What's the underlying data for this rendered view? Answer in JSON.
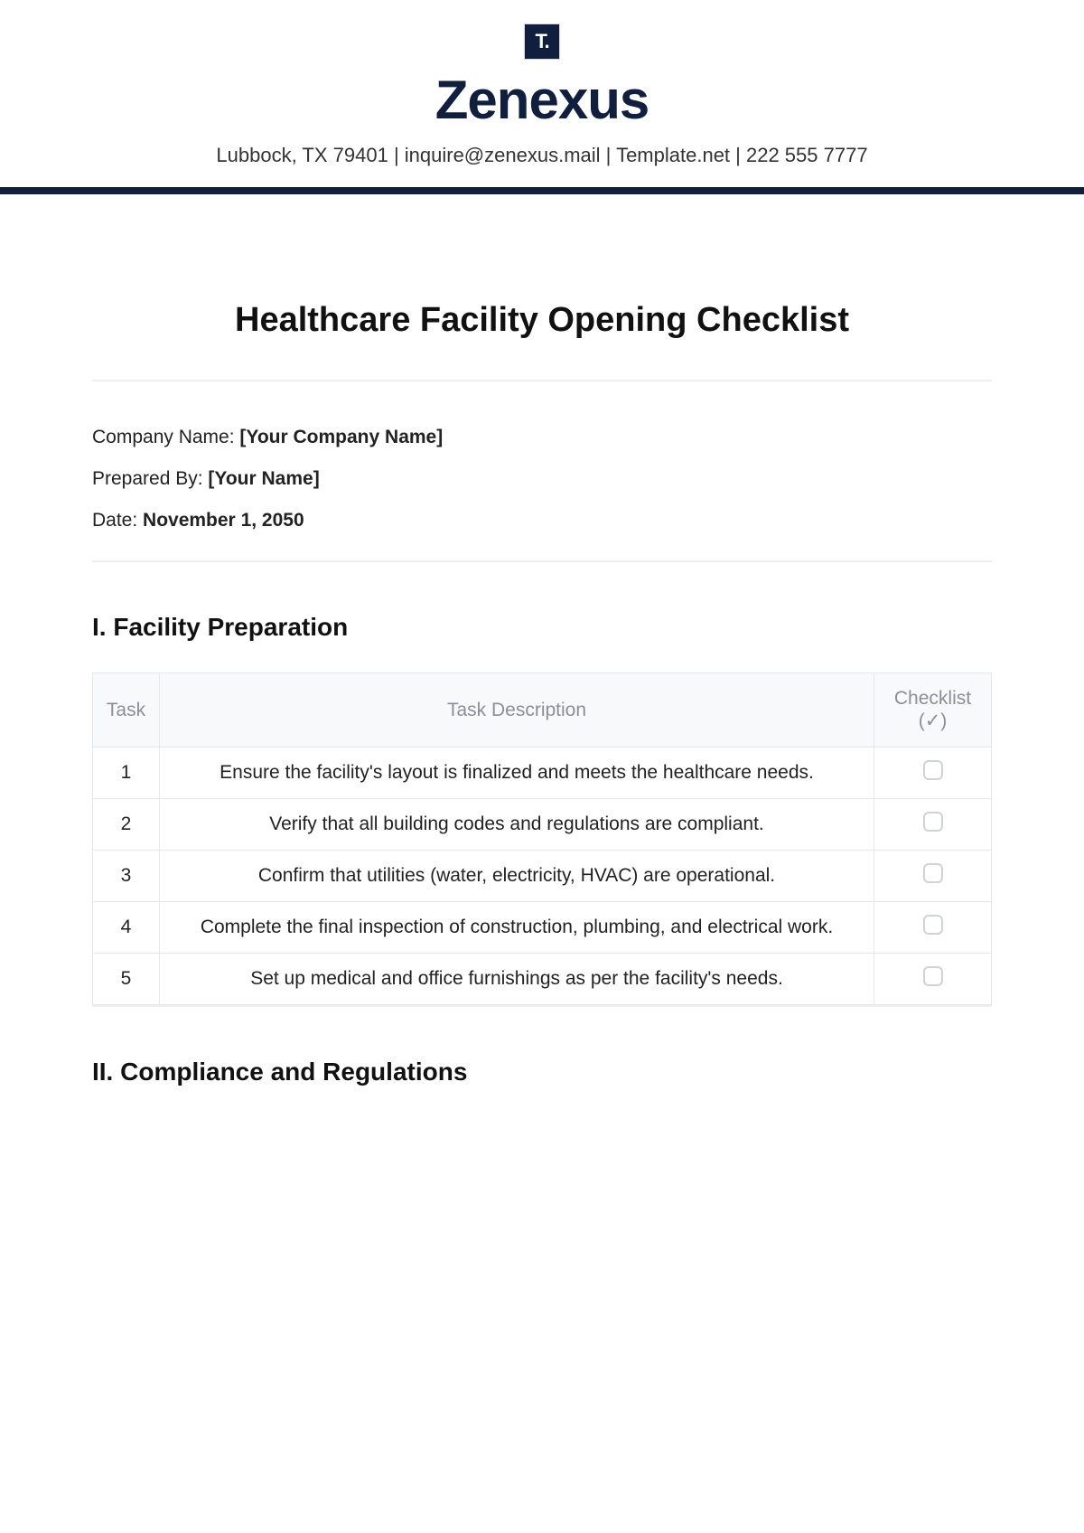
{
  "header": {
    "logo_text": "T.",
    "company": "Zenexus",
    "contact": "Lubbock, TX 79401 | inquire@zenexus.mail | Template.net | 222 555 7777"
  },
  "document": {
    "title": "Healthcare Facility Opening Checklist",
    "meta": {
      "company_label": "Company Name: ",
      "company_value": "[Your Company Name]",
      "prepared_label": "Prepared By: ",
      "prepared_value": "[Your Name]",
      "date_label": "Date: ",
      "date_value": "November 1, 2050"
    }
  },
  "table_headers": {
    "task": "Task",
    "desc": "Task Description",
    "check": "Checklist (✓)"
  },
  "sections": [
    {
      "title": "I. Facility Preparation",
      "rows": [
        {
          "num": "1",
          "desc": "Ensure the facility's layout is finalized and meets the healthcare needs."
        },
        {
          "num": "2",
          "desc": "Verify that all building codes and regulations are compliant."
        },
        {
          "num": "3",
          "desc": "Confirm that utilities (water, electricity, HVAC) are operational."
        },
        {
          "num": "4",
          "desc": "Complete the final inspection of construction, plumbing, and electrical work."
        },
        {
          "num": "5",
          "desc": "Set up medical and office furnishings as per the facility's needs."
        }
      ]
    },
    {
      "title": "II. Compliance and Regulations",
      "rows": []
    }
  ]
}
